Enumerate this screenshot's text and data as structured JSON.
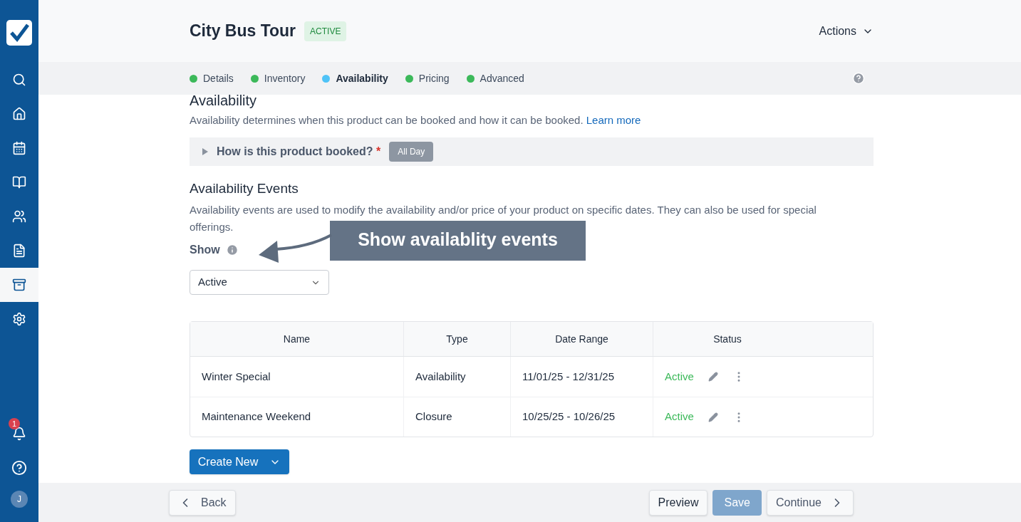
{
  "sidebar": {
    "nav": [
      {
        "kind": "search",
        "selected": false
      },
      {
        "kind": "home",
        "selected": false
      },
      {
        "kind": "calendar",
        "selected": false
      },
      {
        "kind": "book",
        "selected": false
      },
      {
        "kind": "users",
        "selected": false
      },
      {
        "kind": "file",
        "selected": false
      },
      {
        "kind": "archive",
        "selected": true
      },
      {
        "kind": "settings",
        "selected": false
      }
    ],
    "notification_count": "1",
    "avatar": "J"
  },
  "header": {
    "title": "City Bus Tour",
    "status": "ACTIVE",
    "actions": "Actions"
  },
  "steps": [
    {
      "label": "Details",
      "color": "#3cb95a",
      "selected": false
    },
    {
      "label": "Inventory",
      "color": "#3cb95a",
      "selected": false
    },
    {
      "label": "Availability",
      "color": "#4fc3f7",
      "selected": true
    },
    {
      "label": "Pricing",
      "color": "#3cb95a",
      "selected": false
    },
    {
      "label": "Advanced",
      "color": "#3cb95a",
      "selected": false
    }
  ],
  "availability": {
    "title": "Availability",
    "description": "Availability determines when this product can be booked and how it can be booked.",
    "link": "Learn more",
    "booking_question": "How is this product booked?",
    "required_mark": "*",
    "booking_value": "All Day"
  },
  "events": {
    "title": "Availability Events",
    "description": "Availability events are used to modify the availability and/or price of your product on specific dates. They can also be used for special offerings.",
    "show_label": "Show",
    "show_value": "Active",
    "table": {
      "columns": [
        "Name",
        "Type",
        "Date Range",
        "Status"
      ],
      "rows": [
        {
          "name": "Winter Special",
          "type": "Availability",
          "date_range": "11/01/25 - 12/31/25",
          "status": "Active"
        },
        {
          "name": "Maintenance Weekend",
          "type": "Closure",
          "date_range": "10/25/25 - 10/26/25",
          "status": "Active"
        }
      ]
    },
    "create_button": "Create New"
  },
  "callout": "Show availablity events",
  "footer": {
    "back": "Back",
    "preview": "Preview",
    "save": {
      "label": "Save",
      "disabled": true
    },
    "continue": "Continue"
  }
}
